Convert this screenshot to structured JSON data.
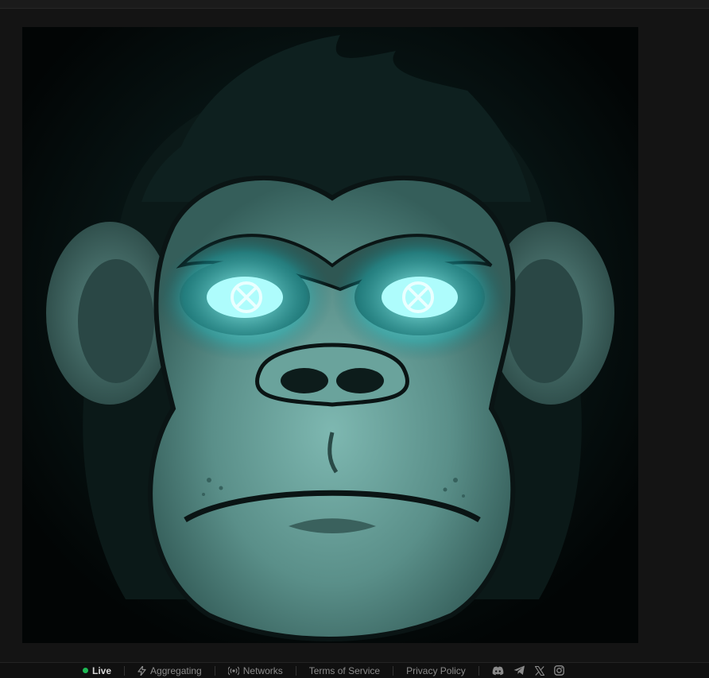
{
  "image": {
    "alt": "",
    "colors": {
      "background": "#030707",
      "fur": "#0c1a19",
      "face": "#5f9690",
      "face_shadow": "#3d6b66",
      "glow": "#40f0f0"
    }
  },
  "footer": {
    "live_label": "Live",
    "live_color": "#1db954",
    "aggregating_label": "Aggregating",
    "networks_label": "Networks",
    "terms_label": "Terms of Service",
    "privacy_label": "Privacy Policy",
    "social_icons": [
      "discord-icon",
      "telegram-icon",
      "x-icon",
      "instagram-icon"
    ]
  }
}
